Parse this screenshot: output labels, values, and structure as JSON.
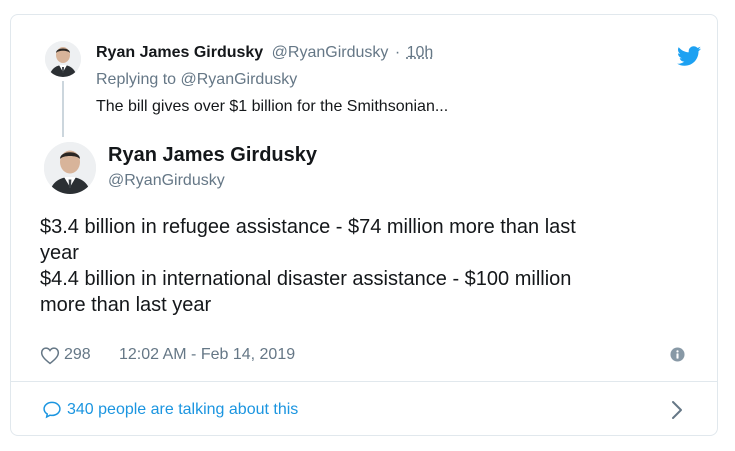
{
  "parent_tweet": {
    "name": "Ryan James Girdusky",
    "handle": "@RyanGirdusky",
    "separator": "·",
    "time": "10h",
    "replying_to": "Replying to @RyanGirdusky",
    "text": "The bill gives over $1 billion for the Smithsonian..."
  },
  "tweet": {
    "name": "Ryan James Girdusky",
    "handle": "@RyanGirdusky",
    "lines": [
      "$3.4 billion in refugee assistance - $74 million more than last",
      "year",
      "$4.4 billion in international disaster assistance - $100 million",
      "more than last year"
    ]
  },
  "footer": {
    "likes": "298",
    "timestamp": "12:02 AM - Feb 14, 2019",
    "talking": "340 people are talking about this"
  },
  "icons": {
    "brand": "twitter-bird-icon",
    "like": "heart-icon",
    "info": "info-icon",
    "reply": "comment-bubble-icon",
    "next": "chevron-right-icon"
  },
  "colors": {
    "accent": "#1da1f2",
    "link": "#1b95e0",
    "muted": "#657786",
    "border": "#e1e8ed",
    "thread_line": "#ccd6dd"
  }
}
